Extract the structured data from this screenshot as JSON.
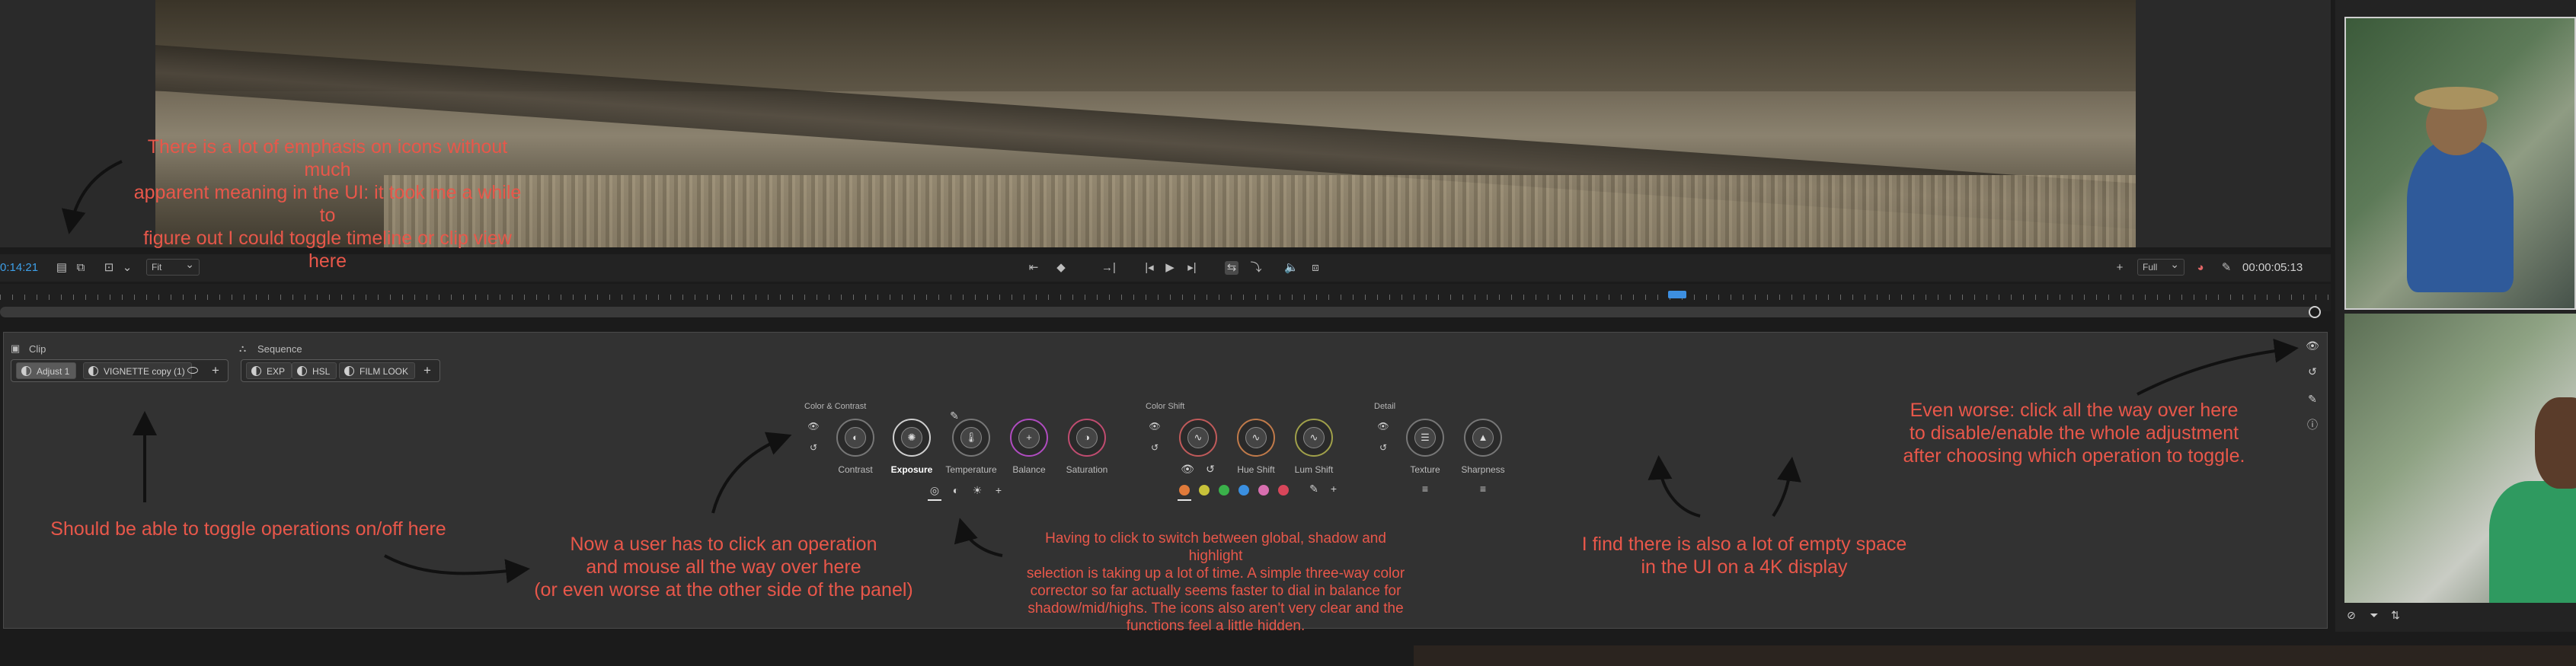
{
  "colors": {
    "annotation": "#e8574a",
    "accent_blue": "#3d9fe8",
    "panel_bg": "#323232"
  },
  "annotations": {
    "icons_emphasis": "There is a lot of emphasis on icons without much\napparent meaning in the UI: it took me a while to\nfigure out I could toggle timeline or clip view here",
    "toggle_ops": "Should be able to toggle operations on/off here",
    "click_operation": "Now a user has to click an operation\nand mouse all the way over here\n(or even worse at the other side of the panel)",
    "global_shadow": "Having to click to switch between global, shadow and highlight\nselection is taking up a lot of time. A simple three-way color\ncorrector so far actually seems faster to dial in balance for\nshadow/mid/highs. The icons also aren't very clear and the\nfunctions feel a little hidden.",
    "empty_space": "I find there is also a lot of empty space\nin the UI on a 4K display",
    "even_worse": "Even worse: click all the way over here\nto disable/enable the whole adjustment\nafter choosing which operation to toggle."
  },
  "transport": {
    "timecode_left": "0:14:21",
    "fit_select": "Fit",
    "full_select": "Full",
    "timecode_right": "00:00:05:13"
  },
  "panel": {
    "clip_tab": "Clip",
    "sequence_tab": "Sequence",
    "clip_chips": [
      "Adjust 1",
      "VIGNETTE copy (1)"
    ],
    "sequence_chips": [
      "EXP",
      "HSL",
      "FILM LOOK"
    ],
    "color_contrast": {
      "title": "Color & Contrast",
      "knobs": [
        "Contrast",
        "Exposure",
        "Temperature",
        "Balance",
        "Saturation"
      ],
      "selected": "Exposure"
    },
    "color_shift": {
      "title": "Color Shift",
      "knobs": [
        "",
        "Hue Shift",
        "Lum Shift"
      ],
      "swatches": [
        "#e07a3a",
        "#c8c23a",
        "#3ab14a",
        "#3a8fe0",
        "#d86fb0",
        "#d8465a"
      ]
    },
    "detail": {
      "title": "Detail",
      "knobs": [
        "Texture",
        "Sharpness"
      ]
    }
  },
  "icons": {
    "clip_tab": "clip-icon",
    "sequence_tab": "sequence-icon",
    "eye": "eye-icon",
    "reset": "reset-icon",
    "wrench": "wrench-icon",
    "info": "info-icon",
    "plus": "plus-icon"
  }
}
